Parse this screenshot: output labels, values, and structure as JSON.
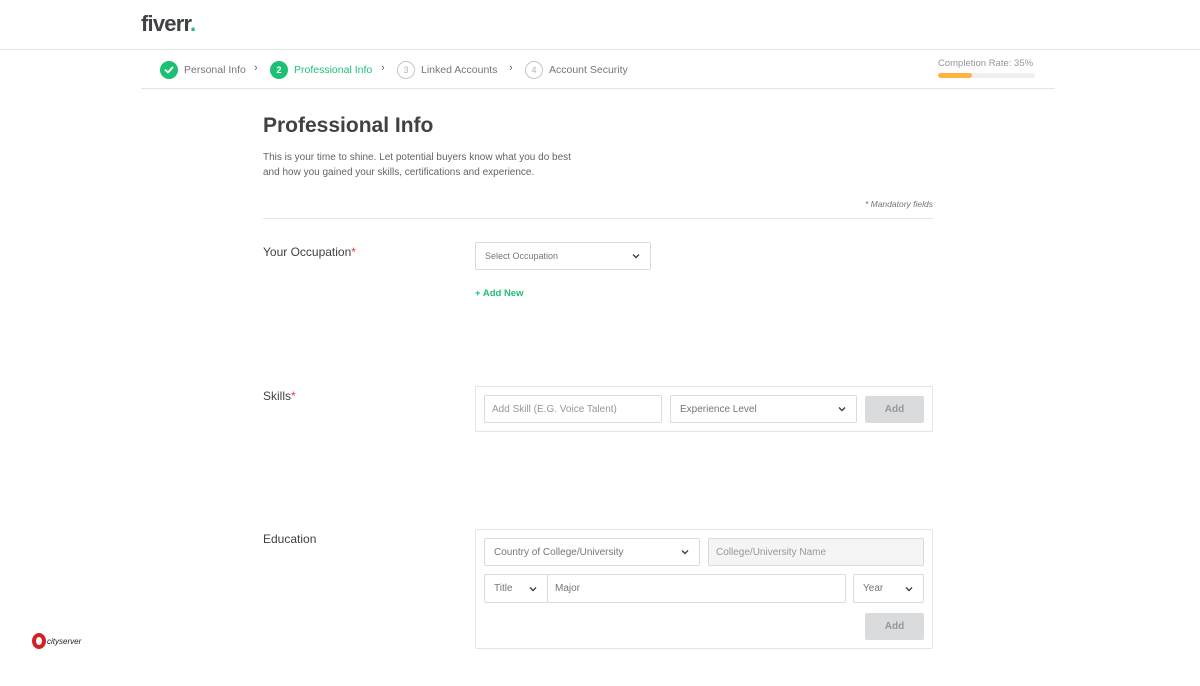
{
  "brand": {
    "logo_text": "fiverr",
    "logo_dot": ".",
    "accent_color": "#1dbf73"
  },
  "stepper": {
    "steps": [
      {
        "number": "✓",
        "label": "Personal Info",
        "state": "done"
      },
      {
        "number": "2",
        "label": "Professional Info",
        "state": "active"
      },
      {
        "number": "3",
        "label": "Linked Accounts",
        "state": "todo"
      },
      {
        "number": "4",
        "label": "Account Security",
        "state": "todo"
      }
    ],
    "separator": "›",
    "completion_label": "Completion Rate: 35%",
    "completion_value": 0.35,
    "progress_color": "#ffb33e"
  },
  "main": {
    "title": "Professional Info",
    "intro": "This is your time to shine. Let potential buyers know what you do best and how you gained your skills, certifications and experience.",
    "mandatory_note": "* Mandatory fields",
    "occupation": {
      "label": "Your Occupation",
      "required_mark": "*",
      "select_placeholder": "Select Occupation",
      "add_new": "+ Add New"
    },
    "skills": {
      "label": "Skills",
      "required_mark": "*",
      "skill_placeholder": "Add Skill (E.G. Voice Talent)",
      "level_placeholder": "Experience Level",
      "add_button": "Add"
    },
    "education": {
      "label": "Education",
      "country_placeholder": "Country of College/University",
      "college_placeholder": "College/University Name",
      "title_placeholder": "Title",
      "major_placeholder": "Major",
      "year_placeholder": "Year",
      "add_button": "Add"
    }
  },
  "watermark": {
    "text": "cityserver"
  }
}
